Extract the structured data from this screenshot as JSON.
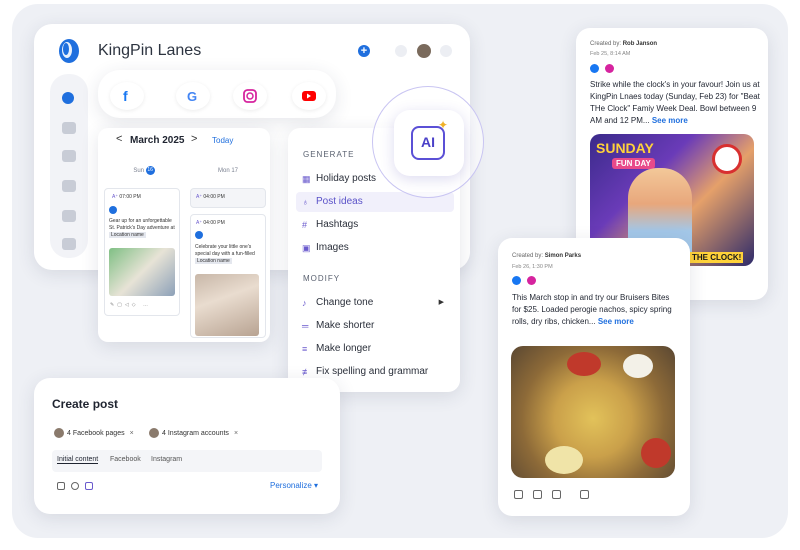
{
  "app": {
    "name": "KingPin Lanes"
  },
  "social_bar": {
    "icons": [
      "facebook-icon",
      "google-icon",
      "instagram-icon",
      "youtube-icon"
    ],
    "colors": {
      "facebook": "#1877f2",
      "instagram": "#d6249f",
      "youtube": "#ff0000"
    }
  },
  "calendar": {
    "month_label": "March 2025",
    "prev": "<",
    "next": ">",
    "today_label": "Today",
    "columns": [
      {
        "day": "Sun",
        "date": "16"
      },
      {
        "day": "Mon",
        "date": "17"
      }
    ],
    "posts": [
      {
        "time": "07:00 PM",
        "text": "Gear up for an unforgettable St. Patrick's Day adventure at",
        "tag": "Location name"
      },
      {
        "time": "04:00 PM"
      },
      {
        "time": "04:00 PM",
        "text": "Celebrate your little one's special day with a fun-filled",
        "tag": "Location name"
      }
    ]
  },
  "ai_menu": {
    "badge": "AI",
    "generate_label": "GENERATE",
    "generate_items": [
      {
        "label": "Holiday posts",
        "icon": "calendar-icon"
      },
      {
        "label": "Post ideas",
        "icon": "lightbulb-icon"
      },
      {
        "label": "Hashtags",
        "icon": "hashtag-icon"
      },
      {
        "label": "Images",
        "icon": "image-icon"
      }
    ],
    "modify_label": "MODIFY",
    "modify_items": [
      {
        "label": "Change tone",
        "icon": "tone-icon"
      },
      {
        "label": "Make shorter",
        "icon": "shorter-icon"
      },
      {
        "label": "Make longer",
        "icon": "longer-icon"
      },
      {
        "label": "Fix spelling and grammar",
        "icon": "spellcheck-icon"
      }
    ],
    "accent": "#5b50d6"
  },
  "create_post": {
    "title": "Create post",
    "chips": [
      {
        "label": "4 Facebook pages"
      },
      {
        "label": "4 Instagram accounts"
      }
    ],
    "tabs": [
      "Initial content",
      "Facebook",
      "Instagram"
    ],
    "personalize": "Personalize ▾"
  },
  "post_rob": {
    "created_by_prefix": "Created by:",
    "author": "Rob Janson",
    "date": "Feb 25, 8:14 AM",
    "text": "Strike while the clock's in your favour! Join us at KingPin Lnaes today (Sunday, Feb 23) for \"Beat THe Clock\" Famiy Week Deal. Bowl between 9 AM and 12 PM...",
    "more": "See more",
    "image_text": {
      "sunday": "SUNDAY",
      "funday": "FUN DAY",
      "clock": "THE CLOCK!"
    }
  },
  "post_simon": {
    "created_by_prefix": "Created by:",
    "author": "Simon Parks",
    "date": "Feb 26, 1:30 PM",
    "text": "This March stop in and try our Bruisers Bites for $25. Loaded perogie nachos, spicy spring rolls, dry ribs, chicken...",
    "more": "See more"
  }
}
